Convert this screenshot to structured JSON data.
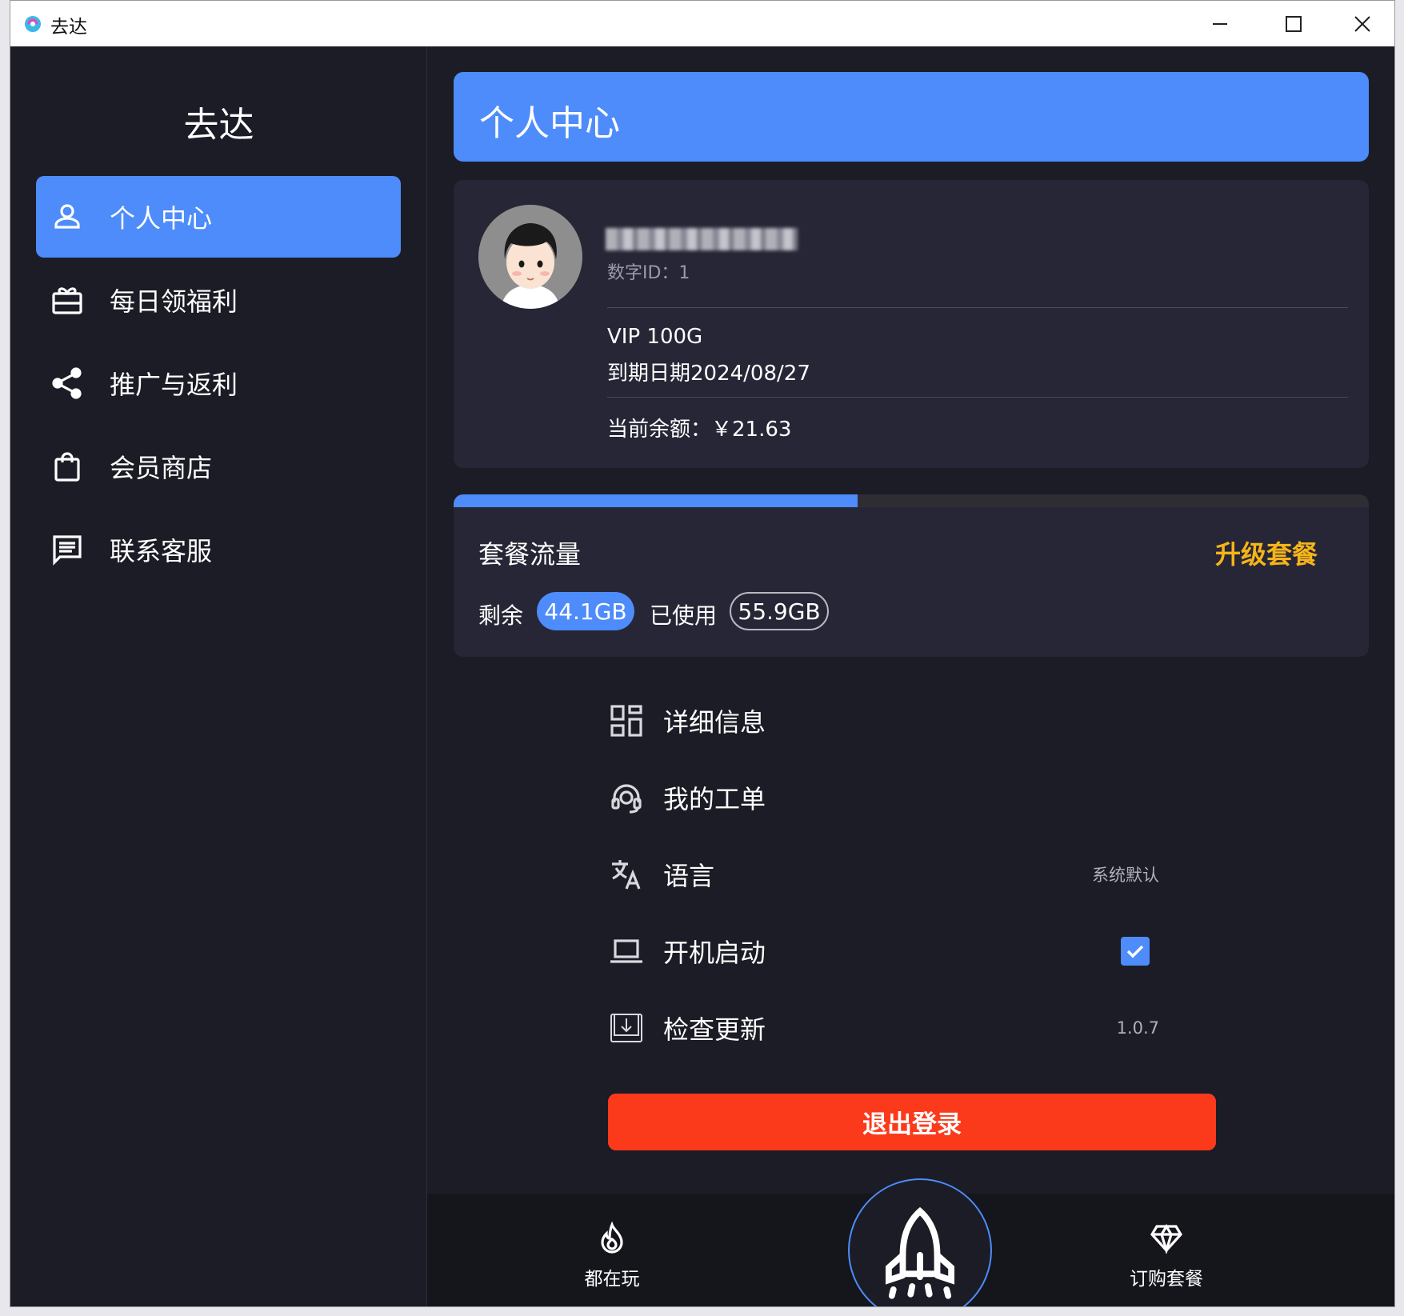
{
  "window": {
    "title": "去达",
    "controls": [
      "minimize-icon",
      "maximize-icon",
      "close-icon"
    ]
  },
  "sidebar": {
    "brand": "去达",
    "items": [
      {
        "label": "个人中心",
        "icon": "user-icon",
        "active": true
      },
      {
        "label": "每日领福利",
        "icon": "gift-icon",
        "active": false
      },
      {
        "label": "推广与返利",
        "icon": "share-icon",
        "active": false
      },
      {
        "label": "会员商店",
        "icon": "shopping-bag-icon",
        "active": false
      },
      {
        "label": "联系客服",
        "icon": "message-icon",
        "active": false
      }
    ]
  },
  "header": {
    "title": "个人中心"
  },
  "profile": {
    "id_label": "数字ID：1",
    "plan": "VIP 100G",
    "expiry": "到期日期2024/08/27",
    "balance": "当前余额：￥21.63"
  },
  "traffic": {
    "title": "套餐流量",
    "upgrade_label": "升级套餐",
    "remaining_label": "剩余",
    "remaining_value": "44.1GB",
    "used_label": "已使用",
    "used_value": "55.9GB",
    "used_fraction": 0.441
  },
  "menu": [
    {
      "label": "详细信息",
      "icon": "grid-icon",
      "value": ""
    },
    {
      "label": "我的工单",
      "icon": "headset-icon",
      "value": ""
    },
    {
      "label": "语言",
      "icon": "translate-icon",
      "value": "系统默认"
    },
    {
      "label": "开机启动",
      "icon": "laptop-icon",
      "value": "",
      "checked": true
    },
    {
      "label": "检查更新",
      "icon": "download-box-icon",
      "value": "1.0.7"
    }
  ],
  "logout_label": "退出登录",
  "bottom_tabs": [
    {
      "label": "都在玩",
      "icon": "fire-icon"
    },
    {
      "label": "",
      "icon": "rocket-icon"
    },
    {
      "label": "订购套餐",
      "icon": "diamond-icon"
    }
  ],
  "colors": {
    "accent": "#4d8cfa",
    "danger": "#fb3a1c",
    "upgrade": "#f5b41a",
    "background": "#1c1c26",
    "card": "#262636"
  }
}
